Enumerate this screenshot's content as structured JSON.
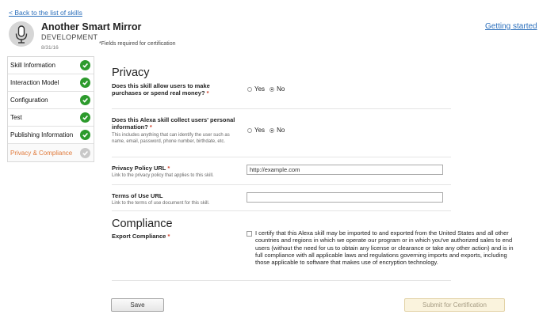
{
  "header": {
    "back_link": "< Back to the list of skills",
    "getting_started": "Getting started",
    "skill_name": "Another Smart Mirror",
    "skill_stage": "DEVELOPMENT",
    "skill_date": "8/31/16",
    "required_note": "*Fields required for certification"
  },
  "sidebar": {
    "items": [
      {
        "label": "Skill Information",
        "status": "complete"
      },
      {
        "label": "Interaction Model",
        "status": "complete"
      },
      {
        "label": "Configuration",
        "status": "complete"
      },
      {
        "label": "Test",
        "status": "complete"
      },
      {
        "label": "Publishing Information",
        "status": "complete"
      },
      {
        "label": "Privacy & Compliance",
        "status": "pending",
        "active": true
      }
    ]
  },
  "privacy": {
    "title": "Privacy",
    "q1": {
      "label": "Does this skill allow users to make purchases or spend real money?",
      "required_marker": "*",
      "yes": "Yes",
      "no": "No",
      "selected": "No"
    },
    "q2": {
      "label": "Does this Alexa skill collect users' personal information?",
      "required_marker": "*",
      "help": "This includes anything that can identify the user such as name, email, password, phone number, birthdate, etc.",
      "yes": "Yes",
      "no": "No",
      "selected": "No"
    },
    "policy_url": {
      "label": "Privacy Policy URL",
      "required_marker": "*",
      "help": "Link to the privacy policy that applies to this skill.",
      "value": "http://example.com"
    },
    "terms_url": {
      "label": "Terms of Use URL",
      "help": "Link to the terms of use document for this skill.",
      "value": ""
    }
  },
  "compliance": {
    "title": "Compliance",
    "export_label": "Export Compliance",
    "required_marker": "*",
    "checked": false,
    "cert_text": "I certify that this Alexa skill may be imported to and exported from the United States and all other countries and regions in which we operate our program or in which you've authorized sales to end users (without the need for us to obtain any license or clearance or take any other action) and is in full compliance with all applicable laws and regulations governing imports and exports, including those applicable to software that makes use of encryption technology."
  },
  "actions": {
    "save": "Save",
    "submit": "Submit for Certification"
  },
  "colors": {
    "link": "#2a6ebb",
    "complete": "#2c9a2c",
    "pending": "#c8c8c8",
    "active_nav": "#e07a3b",
    "required": "#d0402b"
  },
  "icons": {
    "avatar": "microphone-icon",
    "complete": "check-icon"
  }
}
